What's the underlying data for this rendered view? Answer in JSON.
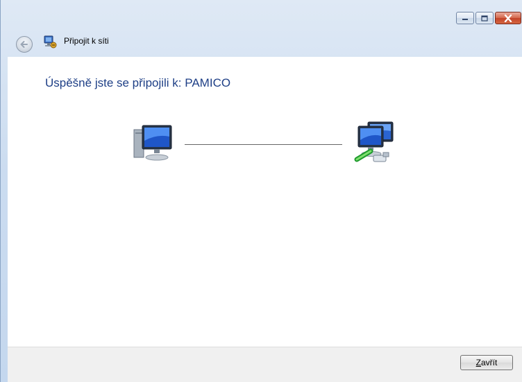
{
  "window": {
    "title": "Připojit k síti"
  },
  "content": {
    "headline_prefix": "Úspěšně jste se připojili k:",
    "network_name": "PAMICO"
  },
  "footer": {
    "close_mnemonic": "Z",
    "close_rest": "avřít"
  },
  "icons": {
    "back": "back-arrow-icon",
    "app": "network-connect-icon",
    "computer": "computer-icon",
    "network": "network-icon",
    "minimize": "minimize-icon",
    "maximize": "maximize-icon",
    "close": "close-icon"
  },
  "colors": {
    "headline": "#1e3f86",
    "close_button": "#c2432a"
  }
}
